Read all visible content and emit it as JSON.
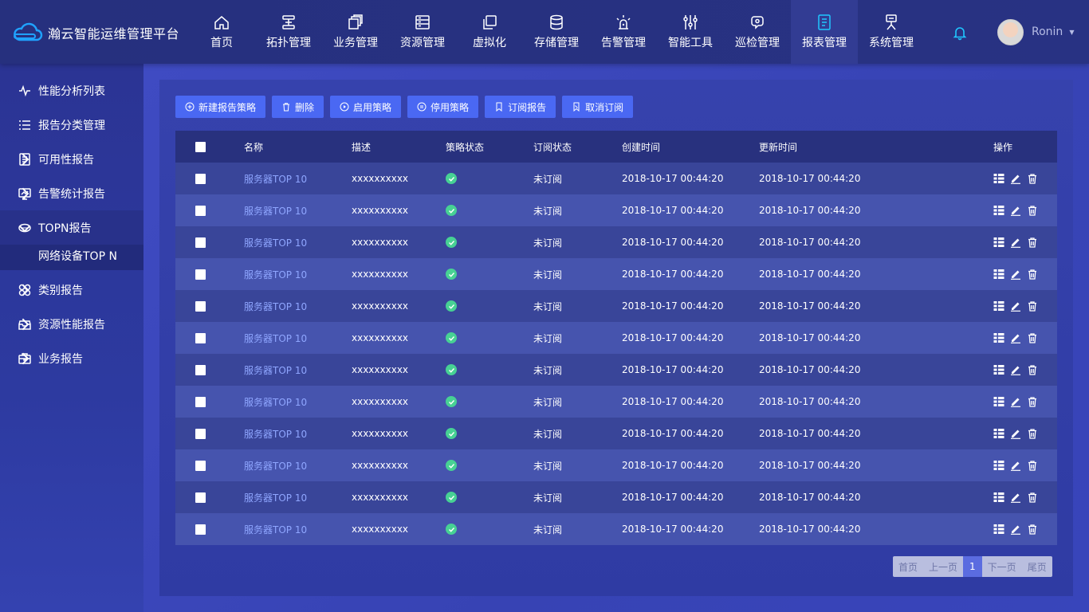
{
  "app": {
    "title": "瀚云智能运维管理平台"
  },
  "nav": [
    {
      "label": "首页",
      "icon": "home-icon"
    },
    {
      "label": "拓扑管理",
      "icon": "topology-icon"
    },
    {
      "label": "业务管理",
      "icon": "business-icon"
    },
    {
      "label": "资源管理",
      "icon": "resource-icon"
    },
    {
      "label": "虚拟化",
      "icon": "virtualization-icon"
    },
    {
      "label": "存储管理",
      "icon": "storage-icon"
    },
    {
      "label": "告警管理",
      "icon": "alarm-icon"
    },
    {
      "label": "智能工具",
      "icon": "tools-icon"
    },
    {
      "label": "巡检管理",
      "icon": "inspection-icon"
    },
    {
      "label": "报表管理",
      "icon": "report-icon",
      "active": true
    },
    {
      "label": "系统管理",
      "icon": "system-icon"
    }
  ],
  "user": {
    "name": "Ronin"
  },
  "sidebar": {
    "items": [
      {
        "label": "性能分析列表",
        "icon": "pulse-icon",
        "arrow": false
      },
      {
        "label": "报告分类管理",
        "icon": "list-icon",
        "arrow": false
      },
      {
        "label": "可用性报告",
        "icon": "doc-icon",
        "arrow": true
      },
      {
        "label": "告警统计报告",
        "icon": "monitor-icon",
        "arrow": true
      },
      {
        "label": "TOPN报告",
        "icon": "topn-icon",
        "arrow": true,
        "open": true
      },
      {
        "label": "类别报告",
        "icon": "category-icon",
        "arrow": true
      },
      {
        "label": "资源性能报告",
        "icon": "resource-perf-icon",
        "arrow": true
      },
      {
        "label": "业务报告",
        "icon": "briefcase-icon",
        "arrow": true
      }
    ],
    "sub_item": "网络设备TOP N"
  },
  "toolbar": {
    "new": "新建报告策略",
    "delete": "删除",
    "enable": "启用策略",
    "disable": "停用策略",
    "subscribe": "订阅报告",
    "unsubscribe": "取消订阅"
  },
  "table": {
    "headers": {
      "name": "名称",
      "desc": "描述",
      "policy_status": "策略状态",
      "subscribe_status": "订阅状态",
      "created": "创建时间",
      "updated": "更新时间",
      "ops": "操作"
    },
    "rows": [
      {
        "name": "服务器TOP 10",
        "desc": "xxxxxxxxxx",
        "policy_status": "enabled",
        "subscribe_status": "未订阅",
        "created": "2018-10-17 00:44:20",
        "updated": "2018-10-17 00:44:20"
      },
      {
        "name": "服务器TOP 10",
        "desc": "xxxxxxxxxx",
        "policy_status": "enabled",
        "subscribe_status": "未订阅",
        "created": "2018-10-17 00:44:20",
        "updated": "2018-10-17 00:44:20"
      },
      {
        "name": "服务器TOP 10",
        "desc": "xxxxxxxxxx",
        "policy_status": "enabled",
        "subscribe_status": "未订阅",
        "created": "2018-10-17 00:44:20",
        "updated": "2018-10-17 00:44:20"
      },
      {
        "name": "服务器TOP 10",
        "desc": "xxxxxxxxxx",
        "policy_status": "enabled",
        "subscribe_status": "未订阅",
        "created": "2018-10-17 00:44:20",
        "updated": "2018-10-17 00:44:20"
      },
      {
        "name": "服务器TOP 10",
        "desc": "xxxxxxxxxx",
        "policy_status": "enabled",
        "subscribe_status": "未订阅",
        "created": "2018-10-17 00:44:20",
        "updated": "2018-10-17 00:44:20"
      },
      {
        "name": "服务器TOP 10",
        "desc": "xxxxxxxxxx",
        "policy_status": "enabled",
        "subscribe_status": "未订阅",
        "created": "2018-10-17 00:44:20",
        "updated": "2018-10-17 00:44:20"
      },
      {
        "name": "服务器TOP 10",
        "desc": "xxxxxxxxxx",
        "policy_status": "enabled",
        "subscribe_status": "未订阅",
        "created": "2018-10-17 00:44:20",
        "updated": "2018-10-17 00:44:20"
      },
      {
        "name": "服务器TOP 10",
        "desc": "xxxxxxxxxx",
        "policy_status": "enabled",
        "subscribe_status": "未订阅",
        "created": "2018-10-17 00:44:20",
        "updated": "2018-10-17 00:44:20"
      },
      {
        "name": "服务器TOP 10",
        "desc": "xxxxxxxxxx",
        "policy_status": "enabled",
        "subscribe_status": "未订阅",
        "created": "2018-10-17 00:44:20",
        "updated": "2018-10-17 00:44:20"
      },
      {
        "name": "服务器TOP 10",
        "desc": "xxxxxxxxxx",
        "policy_status": "enabled",
        "subscribe_status": "未订阅",
        "created": "2018-10-17 00:44:20",
        "updated": "2018-10-17 00:44:20"
      },
      {
        "name": "服务器TOP 10",
        "desc": "xxxxxxxxxx",
        "policy_status": "enabled",
        "subscribe_status": "未订阅",
        "created": "2018-10-17 00:44:20",
        "updated": "2018-10-17 00:44:20"
      },
      {
        "name": "服务器TOP 10",
        "desc": "xxxxxxxxxx",
        "policy_status": "enabled",
        "subscribe_status": "未订阅",
        "created": "2018-10-17 00:44:20",
        "updated": "2018-10-17 00:44:20"
      }
    ]
  },
  "pagination": {
    "first": "首页",
    "prev": "上一页",
    "current": "1",
    "next": "下一页",
    "last": "尾页"
  },
  "colors": {
    "accent": "#4a68f3",
    "status_ok": "#47d194",
    "link": "#8fa6ff"
  }
}
